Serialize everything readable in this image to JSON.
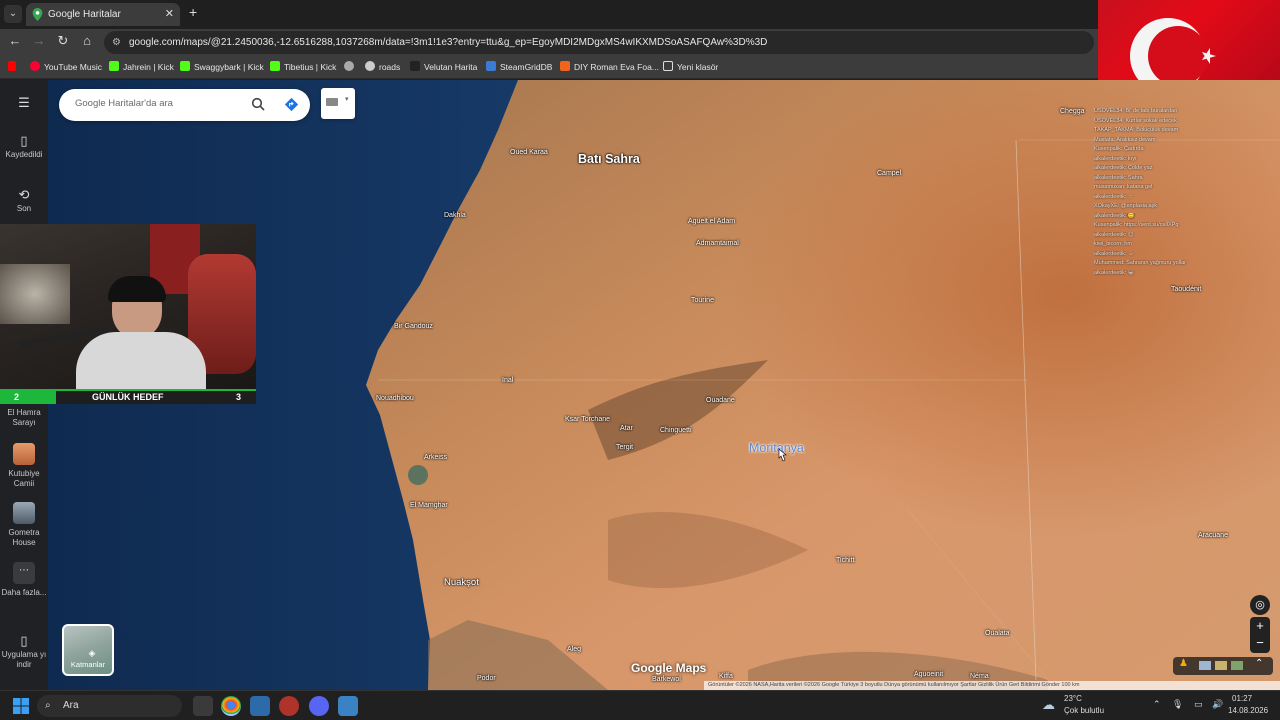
{
  "browser": {
    "tab_title": "Google Haritalar",
    "tab_close": "✕",
    "new_tab": "+",
    "url": "google.com/maps/@21.2450036,-12.6516288,1037268m/data=!3m1!1e3?entry=ttu&g_ep=EgoyMDI2MDgxMS4wIKXMDSoASAFQAw%3D%3D",
    "bookmarks": [
      "YouTube Music",
      "Jahrein | Kick",
      "Swaggybark | Kick",
      "Tibetius | Kick",
      "roads",
      "Velutan Harita",
      "SteamGridDB",
      "DIY Roman Eva Foa...",
      "Yeni klasör"
    ]
  },
  "sidebar": {
    "saved_label": "Kaydedildi",
    "recent_label": "Son",
    "places": [
      "El Hamra Sarayı",
      "Kutubiye Camii",
      "Gometra House"
    ],
    "more_label": "Daha fazla...",
    "app_label": "Uygulama yı indir"
  },
  "search": {
    "placeholder": "Google Haritalar'da ara"
  },
  "stream": {
    "goal_left": "2",
    "goal_label": "GÜNLÜK HEDEF",
    "goal_right": "3",
    "goal_progress": 0.67
  },
  "map": {
    "places": [
      {
        "name": "Batı Sahra",
        "cls": "big"
      },
      {
        "name": "Moritanya",
        "cls": "mori"
      },
      {
        "name": "Nuakşot",
        "cls": "med"
      },
      {
        "name": "Nouadhibou",
        "cls": ""
      },
      {
        "name": "Dakhla",
        "cls": ""
      },
      {
        "name": "Oued Karaa",
        "cls": ""
      },
      {
        "name": "Bir Gandouz",
        "cls": ""
      },
      {
        "name": "Inal",
        "cls": ""
      },
      {
        "name": "Arkeiss",
        "cls": ""
      },
      {
        "name": "El Mamghar",
        "cls": ""
      },
      {
        "name": "Aguelt el Adam",
        "cls": ""
      },
      {
        "name": "Admamtaimal",
        "cls": ""
      },
      {
        "name": "Tourine",
        "cls": ""
      },
      {
        "name": "Ouadane",
        "cls": ""
      },
      {
        "name": "Chinguetti",
        "cls": ""
      },
      {
        "name": "Ksar Torchane",
        "cls": ""
      },
      {
        "name": "Atar",
        "cls": ""
      },
      {
        "name": "Tergit",
        "cls": ""
      },
      {
        "name": "Tichitt",
        "cls": ""
      },
      {
        "name": "Oualata",
        "cls": ""
      },
      {
        "name": "Aleg",
        "cls": ""
      },
      {
        "name": "Podor",
        "cls": ""
      },
      {
        "name": "Kiffa",
        "cls": ""
      },
      {
        "name": "Barkewol",
        "cls": ""
      },
      {
        "name": "Aguoeinit",
        "cls": ""
      },
      {
        "name": "Néma",
        "cls": ""
      },
      {
        "name": "Aracuane",
        "cls": ""
      },
      {
        "name": "Taoudénit",
        "cls": ""
      },
      {
        "name": "Campel",
        "cls": ""
      },
      {
        "name": "Chegga",
        "cls": ""
      }
    ],
    "brand": "Google Maps",
    "attribution": "Görüntüler ©2026 NASA,Harita verileri ©2026 Google   Türkiye   3 boyutlu Dünya görünümü kullanılmıyor   Şartlar   Gizlilik   Ürün Geri Bildirimi Gönder   100 km",
    "layers_label": "Katmanlar"
  },
  "chat": {
    "lines": [
      "USOVEL34: Bi' de tabi buralardan",
      "USOVEL34: Kurtlar sokak edecek",
      "TAKAP_TAKMA: Bölücülük devam",
      "Mustafa: Aralıksız devam",
      "Kusenpalik: Çadırda",
      "alkalerdeetik: kıyı",
      "alkalerdeetik: Çölde yaz",
      "alkalerdeetik: Sahra",
      "muasmuxan: katana gel",
      "alkalerdeetik: ☆",
      "XOkayXE: @enplasia aşk",
      "alkalerdeetik: 🙂",
      "Kusenpalik: https://sent.su/cellXPq",
      "alkalerdeetik: 😊",
      "kiwi_bicorn: hm",
      "alkalerdeetik: ☺",
      "Muhammed: Sahranın yağmuru yollar",
      "alkalerdeetik: 😀"
    ]
  },
  "taskbar": {
    "search_label": "Ara",
    "weather_temp": "23°C",
    "weather_desc": "Çok bulutlu",
    "time": "01:27",
    "date": "14.08.2026"
  }
}
